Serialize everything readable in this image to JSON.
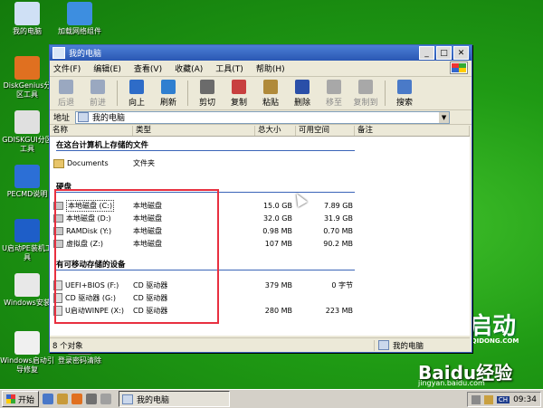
{
  "desktop": {
    "icons": [
      {
        "label": "我的电脑",
        "color": "#cfe0f5"
      },
      {
        "label": "加载网络组件",
        "color": "#3d8ee0"
      },
      {
        "label": "DiskGenius分区工具",
        "color": "#e07020"
      },
      {
        "label": "GDISKGUI分区工具",
        "color": "#e0e0e0"
      },
      {
        "label": "PECMD说明",
        "color": "#2c6fd6"
      },
      {
        "label": "U启动PE装机工具",
        "color": "#1e5ec8"
      },
      {
        "label": "Windows安装",
        "color": "#e8e8e8"
      },
      {
        "label": "Windows启动引导修复",
        "color": "#f0f0f0"
      },
      {
        "label": "登录密码清除",
        "color": "#8a8a8a"
      }
    ],
    "brand_text": "启动",
    "brand_sub": "UQIDONG.COM",
    "watermark": "Baidu经验",
    "watermark_sub": "jingyan.baidu.com"
  },
  "window": {
    "title": "我的电脑",
    "menu": [
      "文件(F)",
      "编辑(E)",
      "查看(V)",
      "收藏(A)",
      "工具(T)",
      "帮助(H)"
    ],
    "toolbar": [
      {
        "label": "后退",
        "icon": "back-arrow-icon",
        "color": "#9aa8c0",
        "disabled": true
      },
      {
        "label": "前进",
        "icon": "forward-arrow-icon",
        "color": "#9aa8c0",
        "disabled": true
      },
      {
        "label": "向上",
        "icon": "up-arrow-icon",
        "color": "#2e6cc8",
        "disabled": false
      },
      {
        "label": "刷新",
        "icon": "refresh-icon",
        "color": "#2f7fd0",
        "disabled": false
      },
      {
        "label": "剪切",
        "icon": "scissors-icon",
        "color": "#6b6b6b",
        "disabled": false
      },
      {
        "label": "复制",
        "icon": "copy-icon",
        "color": "#c84040",
        "disabled": false
      },
      {
        "label": "粘贴",
        "icon": "paste-icon",
        "color": "#b08a3a",
        "disabled": false
      },
      {
        "label": "删除",
        "icon": "delete-icon",
        "color": "#2a4fa8",
        "disabled": false
      },
      {
        "label": "移至",
        "icon": "move-to-icon",
        "color": "#a8a8a8",
        "disabled": true
      },
      {
        "label": "复制到",
        "icon": "copy-to-icon",
        "color": "#a8a8a8",
        "disabled": true
      },
      {
        "label": "搜索",
        "icon": "search-icon",
        "color": "#4a7ac8",
        "disabled": false
      }
    ],
    "address_label": "地址",
    "address_value": "我的电脑",
    "columns": {
      "name": "名称",
      "type": "类型",
      "total": "总大小",
      "free": "可用空间",
      "note": "备注"
    },
    "groups": {
      "files": "在这台计算机上存储的文件",
      "hdd": "硬盘",
      "removable": "有可移动存储的设备"
    },
    "file_items": [
      {
        "name": "Documents",
        "type": "文件夹"
      }
    ],
    "hdd_items": [
      {
        "name": "本地磁盘 (C:)",
        "type": "本地磁盘",
        "total": "15.0 GB",
        "free": "7.89 GB"
      },
      {
        "name": "本地磁盘 (D:)",
        "type": "本地磁盘",
        "total": "32.0 GB",
        "free": "31.9 GB"
      },
      {
        "name": "RAMDisk (Y:)",
        "type": "本地磁盘",
        "total": "0.98 MB",
        "free": "0.70 MB"
      },
      {
        "name": "虚拟盘 (Z:)",
        "type": "本地磁盘",
        "total": "107 MB",
        "free": "90.2 MB"
      }
    ],
    "removable_items": [
      {
        "name": "UEFI+BIOS (F:)",
        "type": "CD 驱动器",
        "total": "379 MB",
        "free": "0 字节"
      },
      {
        "name": "CD 驱动器 (G:)",
        "type": "CD 驱动器",
        "total": "",
        "free": ""
      },
      {
        "name": "U启动WINPE (X:)",
        "type": "CD 驱动器",
        "total": "280 MB",
        "free": "223 MB"
      }
    ],
    "status_left": "8 个对象",
    "status_right": "我的电脑"
  },
  "taskbar": {
    "start_label": "开始",
    "task_label": "我的电脑",
    "lang": "CH",
    "clock": "09:34"
  }
}
